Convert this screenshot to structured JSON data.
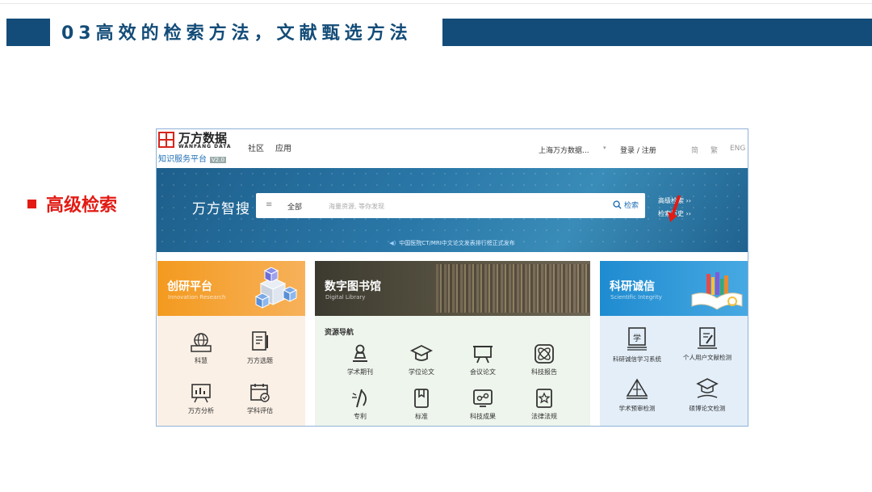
{
  "slide": {
    "title": "03高效的检索方法，文献甄选方法",
    "bullet": "高级检索"
  },
  "site": {
    "logo_cn": "万方数据",
    "logo_en": "WANFANG DATA",
    "logo_sub": "知识服务平台",
    "logo_version": "V2.0",
    "nav": [
      "社区",
      "应用"
    ],
    "org": "上海万方数据...",
    "org_caret": "▾",
    "login": "登录 / 注册",
    "langs": [
      "简",
      "繁",
      "ENG"
    ]
  },
  "hero": {
    "brand": "万方智搜",
    "menu_icon": "≡",
    "scope": "全部",
    "placeholder": "海量资源, 等你发现",
    "search_label": "检索",
    "advanced": "高级检索 ››",
    "history": "检索历史 ››",
    "notice": "中国医院CT/MRI中文论文发表排行榜正式发布"
  },
  "panels": {
    "innovation": {
      "title": "创研平台",
      "en": "Innovation Research",
      "items": [
        "科慧",
        "万方选题",
        "万方分析",
        "学科评估"
      ]
    },
    "library": {
      "title": "数字图书馆",
      "en": "Digital Library",
      "section": "资源导航",
      "items": [
        "学术期刊",
        "学位论文",
        "会议论文",
        "科技报告",
        "专利",
        "标准",
        "科技成果",
        "法律法规"
      ]
    },
    "integrity": {
      "title": "科研诚信",
      "en": "Scientific Integrity",
      "items": [
        "科研诚信学习系统",
        "个人用户文献检测",
        "学术预审检测",
        "硕博论文检测"
      ]
    }
  },
  "colors": {
    "slide_blue": "#134c78",
    "bullet_red": "#e21b14",
    "brand_red": "#d7261b",
    "link_blue": "#1f6fb5",
    "hero_blue": "#2a78a8",
    "orange": "#f39a1f",
    "sky": "#1f8bd0"
  }
}
